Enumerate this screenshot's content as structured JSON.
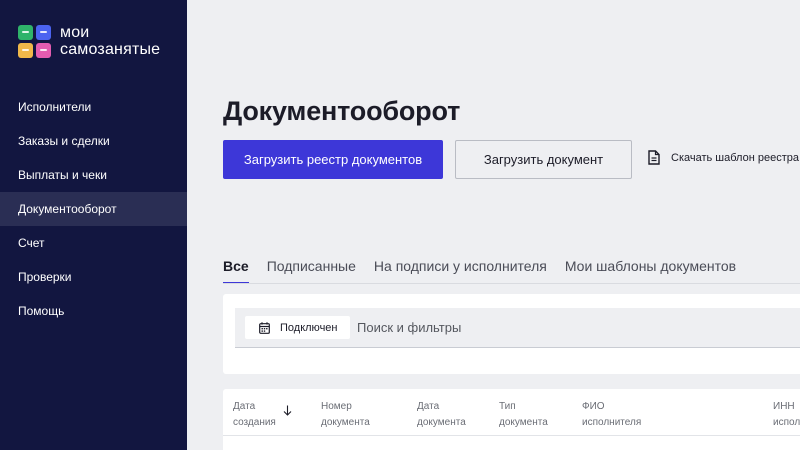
{
  "brand": {
    "line1": "мои",
    "line2": "самозанятые"
  },
  "nav": {
    "items": [
      {
        "label": "Исполнители"
      },
      {
        "label": "Заказы и сделки"
      },
      {
        "label": "Выплаты и чеки"
      },
      {
        "label": "Документооборот",
        "active": true
      },
      {
        "label": "Счет"
      },
      {
        "label": "Проверки"
      },
      {
        "label": "Помощь"
      }
    ]
  },
  "page": {
    "title": "Документооборот",
    "upload_registry_label": "Загрузить реестр документов",
    "upload_document_label": "Загрузить документ",
    "download_template_label": "Скачать шаблон реестра"
  },
  "tabs": [
    {
      "label": "Все",
      "active": true
    },
    {
      "label": "Подписанные"
    },
    {
      "label": "На подписи у исполнителя"
    },
    {
      "label": "Мои шаблоны документов"
    }
  ],
  "filter": {
    "chip_label": "Подключен",
    "search_placeholder": "Поиск и фильтры"
  },
  "table": {
    "columns": [
      {
        "line1": "Дата",
        "line2": "создания"
      },
      {
        "line1": "Номер",
        "line2": "документа"
      },
      {
        "line1": "Дата",
        "line2": "документа"
      },
      {
        "line1": "Тип",
        "line2": "документа"
      },
      {
        "line1": "ФИО",
        "line2": "исполнителя"
      },
      {
        "line1": "ИНН",
        "line2": "испол"
      }
    ]
  },
  "colors": {
    "sidebar_bg": "#121640",
    "sidebar_active": "#2a2e54",
    "accent": "#3d37d8",
    "page_bg": "#eeeff2"
  }
}
